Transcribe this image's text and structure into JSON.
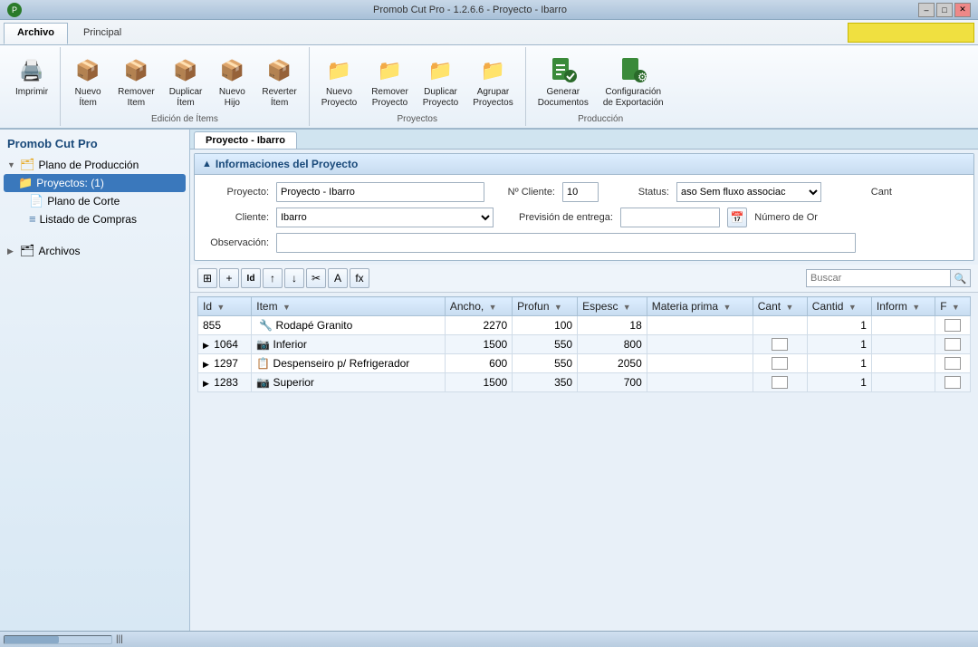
{
  "titleBar": {
    "title": "Promob Cut Pro - 1.2.6.6 - Proyecto - Ibarro",
    "logoColor": "#2a7a2a"
  },
  "ribbonTabs": [
    {
      "id": "archivo",
      "label": "Archivo",
      "active": true
    },
    {
      "id": "principal",
      "label": "Principal",
      "active": false
    }
  ],
  "ribbonGroups": [
    {
      "id": "imprimir",
      "items": [
        {
          "id": "imprimir",
          "icon": "🖨",
          "label": "Imprimir"
        }
      ],
      "label": ""
    },
    {
      "id": "edicion",
      "items": [
        {
          "id": "nuevo-item",
          "icon": "📦",
          "label": "Nuevo\nÍtem"
        },
        {
          "id": "remover-item",
          "icon": "📦",
          "label": "Remover\nItem"
        },
        {
          "id": "duplicar-item",
          "icon": "📦",
          "label": "Duplicar\nÍtem"
        },
        {
          "id": "nuevo-hijo",
          "icon": "📦",
          "label": "Nuevo\nHijo"
        },
        {
          "id": "reverter-item",
          "icon": "📦",
          "label": "Reverter\nÍtem"
        }
      ],
      "label": "Edición de Ítems"
    },
    {
      "id": "proyectos",
      "items": [
        {
          "id": "nuevo-proyecto",
          "icon": "📁",
          "label": "Nuevo\nProyecto"
        },
        {
          "id": "remover-proyecto",
          "icon": "📁",
          "label": "Remover\nProyecto"
        },
        {
          "id": "duplicar-proyecto",
          "icon": "📁",
          "label": "Duplicar\nProyecto"
        },
        {
          "id": "agrupar-proyectos",
          "icon": "📁",
          "label": "Agrupar\nProyectos"
        }
      ],
      "label": "Proyectos"
    },
    {
      "id": "produccion",
      "items": [
        {
          "id": "generar-documentos",
          "icon": "📄",
          "label": "Generar\nDocumentos"
        },
        {
          "id": "configuracion-exportacion",
          "icon": "⚙",
          "label": "Configuración\nde Exportación"
        }
      ],
      "label": "Producción"
    }
  ],
  "sidebar": {
    "title": "Promob Cut Pro",
    "tree": [
      {
        "id": "plano-produccion",
        "label": "Plano de Producción",
        "indent": 0,
        "arrow": "▼",
        "icon": "🗂",
        "type": "folder"
      },
      {
        "id": "proyectos",
        "label": "Proyectos: (1)",
        "indent": 1,
        "arrow": "",
        "icon": "📁",
        "type": "folder",
        "selected": true
      },
      {
        "id": "plano-corte",
        "label": "Plano de Corte",
        "indent": 2,
        "arrow": "",
        "icon": "📄",
        "type": "file"
      },
      {
        "id": "listado-compras",
        "label": "Listado de Compras",
        "indent": 2,
        "arrow": "",
        "icon": "≡",
        "type": "file"
      }
    ],
    "archivos": {
      "label": "Archivos",
      "indent": 0,
      "arrow": "▶",
      "icon": "🗂"
    }
  },
  "contentTab": "Proyecto - Ibarro",
  "projectInfo": {
    "sectionTitle": "Informaciones del Proyecto",
    "fields": {
      "proyecto": {
        "label": "Proyecto:",
        "value": "Proyecto - Ibarro"
      },
      "noCliente": {
        "label": "Nº Cliente:",
        "value": "10"
      },
      "status": {
        "label": "Status:",
        "value": "aso Sem fluxo associac"
      },
      "cant": {
        "label": "Cant"
      },
      "cliente": {
        "label": "Cliente:",
        "value": "Ibarro"
      },
      "previsionEntrega": {
        "label": "Previsión de entrega:"
      },
      "numeroOrden": {
        "label": "Número de Or"
      },
      "observacion": {
        "label": "Observación:",
        "value": ""
      }
    }
  },
  "toolbar": {
    "buttons": [
      "⊞",
      "+",
      "🆔",
      "↑",
      "↓",
      "✂",
      "A",
      "fx"
    ],
    "searchPlaceholder": "Buscar"
  },
  "table": {
    "columns": [
      "Id",
      "Item",
      "Ancho,",
      "Profun",
      "Espesc",
      "Materia prima",
      "Cant",
      "Cantid",
      "Inform",
      "F"
    ],
    "rows": [
      {
        "id": "855",
        "expander": "",
        "item": "Rodapé Granito",
        "icon": "🔧",
        "ancho": "2270",
        "profun": "100",
        "espesc": "18",
        "materia": "",
        "cant": "",
        "cantid": "1",
        "inform": "",
        "f": false
      },
      {
        "id": "1064",
        "expander": "▶",
        "item": "Inferior",
        "icon": "📷",
        "ancho": "1500",
        "profun": "550",
        "espesc": "800",
        "materia": "",
        "cant": "☐",
        "cantid": "1",
        "inform": "",
        "f": false
      },
      {
        "id": "1297",
        "expander": "▶",
        "item": "Despenseiro p/ Refrigerador",
        "icon": "📋",
        "ancho": "600",
        "profun": "550",
        "espesc": "2050",
        "materia": "",
        "cant": "☐",
        "cantid": "1",
        "inform": "",
        "f": false
      },
      {
        "id": "1283",
        "expander": "▶",
        "item": "Superior",
        "icon": "📷",
        "ancho": "1500",
        "profun": "350",
        "espesc": "700",
        "materia": "",
        "cant": "☐",
        "cantid": "1",
        "inform": "",
        "f": false
      }
    ]
  },
  "statusBar": {
    "scrollText": ""
  }
}
